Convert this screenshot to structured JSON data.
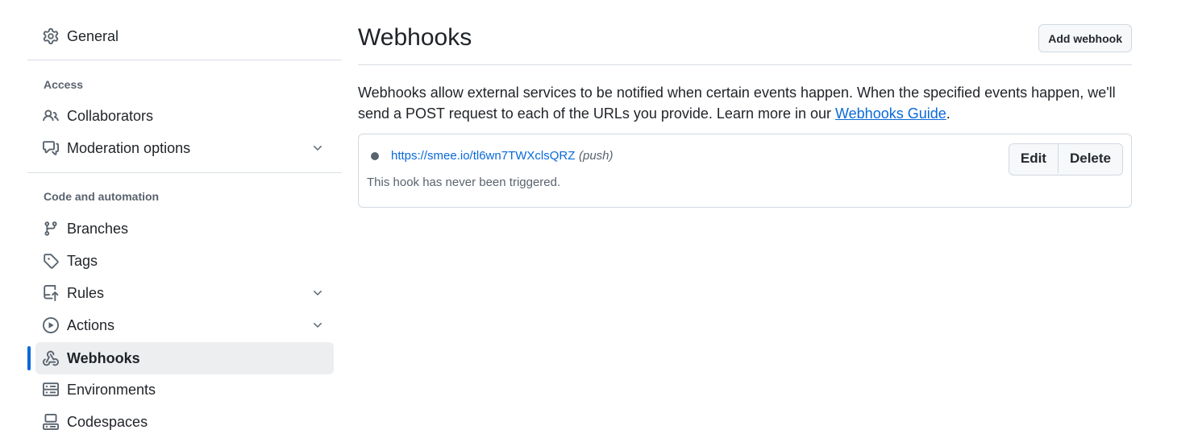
{
  "sidebar": {
    "general": {
      "label": "General",
      "icon": "gear-icon"
    },
    "sections": [
      {
        "heading": "Access"
      },
      {
        "heading": "Code and automation"
      }
    ],
    "access_items": [
      {
        "label": "Collaborators",
        "icon": "people-icon"
      },
      {
        "label": "Moderation options",
        "icon": "comment-discussion-icon",
        "expandable": true
      }
    ],
    "code_items": [
      {
        "label": "Branches",
        "icon": "git-branch-icon"
      },
      {
        "label": "Tags",
        "icon": "tag-icon"
      },
      {
        "label": "Rules",
        "icon": "repo-push-icon",
        "expandable": true
      },
      {
        "label": "Actions",
        "icon": "play-icon",
        "expandable": true
      },
      {
        "label": "Webhooks",
        "icon": "webhook-icon",
        "active": true
      },
      {
        "label": "Environments",
        "icon": "server-icon"
      },
      {
        "label": "Codespaces",
        "icon": "codespaces-icon"
      }
    ]
  },
  "main": {
    "title": "Webhooks",
    "add_button": "Add webhook",
    "description": "Webhooks allow external services to be notified when certain events happen. When the specified events happen, we'll send a POST request to each of the URLs you provide. Learn more in our ",
    "guide_link": "Webhooks Guide",
    "description_end": ".",
    "hook": {
      "url": "https://smee.io/tl6wn7TWXclsQRZ",
      "events": "(push)",
      "status": "This hook has never been triggered.",
      "edit_label": "Edit",
      "delete_label": "Delete"
    }
  },
  "colors": {
    "accent": "#0969da",
    "active_bg": "#eceef0",
    "muted": "#59636e"
  }
}
